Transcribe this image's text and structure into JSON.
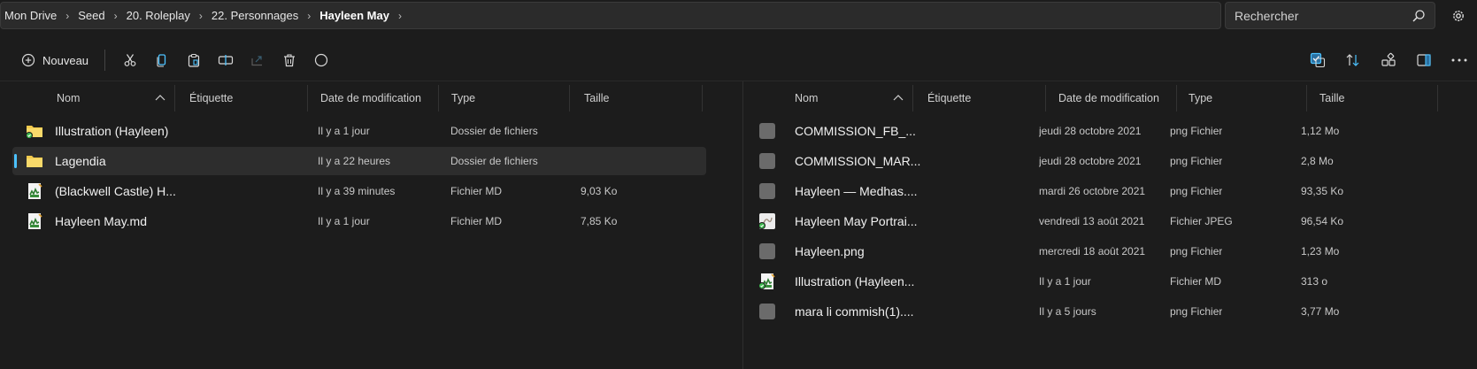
{
  "breadcrumb": [
    "Mon Drive",
    "Seed",
    "20. Roleplay",
    "22. Personnages",
    "Hayleen May"
  ],
  "search": {
    "placeholder": "Rechercher"
  },
  "toolbar": {
    "new_label": "Nouveau"
  },
  "columns": {
    "name": "Nom",
    "tag": "Étiquette",
    "date": "Date de modification",
    "type": "Type",
    "size": "Taille"
  },
  "left_files": [
    {
      "name": "Illustration (Hayleen)",
      "date": "Il y a 1 jour",
      "type": "Dossier de fichiers",
      "size": "",
      "icon": "folder-synced-icon"
    },
    {
      "name": "Lagendia",
      "date": "Il y a 22 heures",
      "type": "Dossier de fichiers",
      "size": "",
      "icon": "folder-icon"
    },
    {
      "name": "(Blackwell Castle) H...",
      "date": "Il y a 39 minutes",
      "type": "Fichier MD",
      "size": "9,03 Ko",
      "icon": "md-file-icon"
    },
    {
      "name": "Hayleen May.md",
      "date": "Il y a 1 jour",
      "type": "Fichier MD",
      "size": "7,85 Ko",
      "icon": "md-file-icon"
    }
  ],
  "right_files": [
    {
      "name": "COMMISSION_FB_...",
      "date": "jeudi 28 octobre 2021",
      "type": "png Fichier",
      "size": "1,12 Mo",
      "icon": "png-file-icon"
    },
    {
      "name": "COMMISSION_MAR...",
      "date": "jeudi 28 octobre 2021",
      "type": "png Fichier",
      "size": "2,8 Mo",
      "icon": "png-file-icon"
    },
    {
      "name": "Hayleen — Medhas....",
      "date": "mardi 26 octobre 2021",
      "type": "png Fichier",
      "size": "93,35 Ko",
      "icon": "png-file-icon"
    },
    {
      "name": "Hayleen May Portrai...",
      "date": "vendredi 13 août 2021",
      "type": "Fichier JPEG",
      "size": "96,54 Ko",
      "icon": "jpeg-file-icon"
    },
    {
      "name": "Hayleen.png",
      "date": "mercredi 18 août 2021",
      "type": "png Fichier",
      "size": "1,23 Mo",
      "icon": "png-file-icon"
    },
    {
      "name": "Illustration (Hayleen...",
      "date": "Il y a 1 jour",
      "type": "Fichier MD",
      "size": "313 o",
      "icon": "md-file-synced-icon"
    },
    {
      "name": "mara li commish(1)....",
      "date": "Il y a 5 jours",
      "type": "png Fichier",
      "size": "3,77 Mo",
      "icon": "png-file-icon"
    }
  ],
  "colors": {
    "accent": "#4cc2ff",
    "folder": "#f2c94c",
    "background": "#1c1c1c",
    "selected_row": "#2d2d2d"
  }
}
